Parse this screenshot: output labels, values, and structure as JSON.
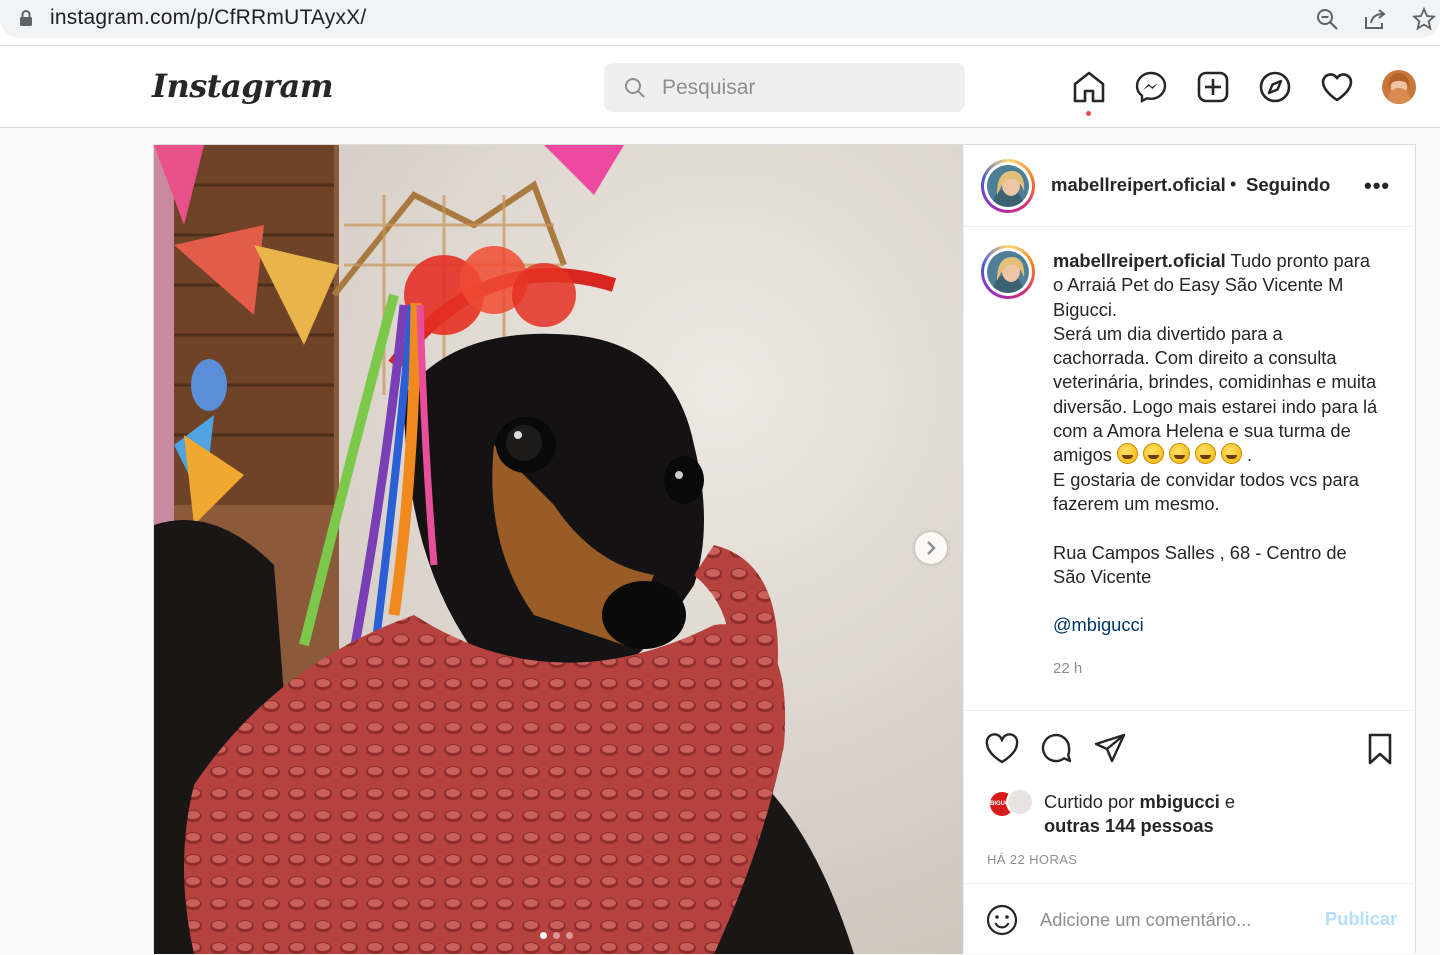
{
  "browser": {
    "url": "instagram.com/p/CfRRmUTAyxX/",
    "icons": [
      "lock-icon",
      "zoom-icon",
      "share-icon",
      "star-icon"
    ]
  },
  "header": {
    "logo": "Instagram",
    "search_placeholder": "Pesquisar",
    "nav_icons": [
      "home-icon",
      "messenger-icon",
      "new-post-icon",
      "explore-icon",
      "activity-heart-icon",
      "profile-avatar"
    ],
    "notification_dot_color": "#ed4956"
  },
  "post": {
    "image_alt": "Dachshund with red knit scarf and festa junina ribbons",
    "carousel": {
      "count": 3,
      "active": 1
    },
    "author": {
      "username": "mabellreipert.oficial",
      "separator": "•",
      "follow_status": "Seguindo"
    },
    "caption": {
      "username": "mabellreipert.oficial",
      "first_line": "Tudo pronto para o Arraiá Pet do Easy São Vicente M Bigucci.",
      "line2": "Será um dia divertido para a cachorrada. Com direito a consulta veterinária, brindes, comidinhas e muita diversão. Logo mais estarei indo para lá com a Amora Helena e sua turma de amigos",
      "emoji_tail": ".",
      "line3": "E gostaria de convidar todos vcs para fazerem um mesmo.",
      "address": "Rua Campos Salles , 68 - Centro de São Vicente",
      "mention": "@mbigucci",
      "time": "22 h"
    },
    "likes": {
      "prefix": "Curtido por",
      "user": "mbigucci",
      "conj": "e",
      "others": "outras 144 pessoas",
      "avatar1_text": "BIGUCCI"
    },
    "timestamp": "HÁ 22 HORAS",
    "comment": {
      "placeholder": "Adicione um comentário...",
      "publish": "Publicar"
    }
  },
  "colors": {
    "link": "#00376b",
    "publish_disabled": "#b2dffc",
    "muted": "#8e8e8e"
  }
}
